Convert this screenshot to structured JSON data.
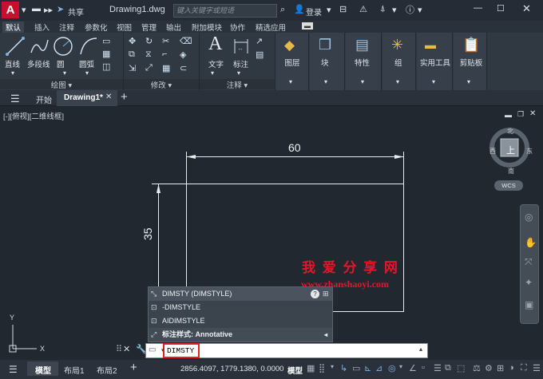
{
  "titlebar": {
    "logo": "A",
    "share": "共享",
    "filename": "Drawing1.dwg",
    "search_placeholder": "键入关键字或短语",
    "login": "登录"
  },
  "ribbon_tabs": [
    "默认",
    "插入",
    "注释",
    "参数化",
    "视图",
    "管理",
    "输出",
    "附加模块",
    "协作",
    "精选应用"
  ],
  "draw_panel": {
    "tools": [
      "直线",
      "多段线",
      "圆",
      "圆弧"
    ],
    "label": "绘图"
  },
  "modify_panel": {
    "label": "修改"
  },
  "annotation_panel": {
    "tools": [
      "文字",
      "标注"
    ],
    "label": "注释"
  },
  "big_panels": [
    "图层",
    "块",
    "特性",
    "组",
    "实用工具",
    "剪贴板"
  ],
  "doc_tabs": {
    "start": "开始",
    "active": "Drawing1*"
  },
  "viewport_label": "[-][俯视][二维线框]",
  "viewcube": {
    "north": "北",
    "south": "南",
    "west": "西",
    "east": "东",
    "top": "上",
    "wcs": "WCS"
  },
  "drawing": {
    "dim_h": "60",
    "dim_v": "35"
  },
  "watermark": {
    "title": "我 爱 分 享 网",
    "url": "www.zhanshaoyi.com"
  },
  "autocomplete": [
    {
      "text": "DIMSTY (DIMSTYLE)",
      "icon": "dimstyle-icon"
    },
    {
      "text": "-DIMSTYLE",
      "icon": "dimstyle-icon"
    },
    {
      "text": "AIDIMSTYLE",
      "icon": "dimstyle-icon"
    },
    {
      "text": "标注样式: Annotative",
      "icon": "dimension-style-icon"
    }
  ],
  "command": {
    "value": "DIMSTY"
  },
  "status": {
    "model_tab": "模型",
    "layout1": "布局1",
    "layout2": "布局2",
    "coords": "2856.4097, 1779.1380, 0.0000",
    "mode": "模型"
  }
}
